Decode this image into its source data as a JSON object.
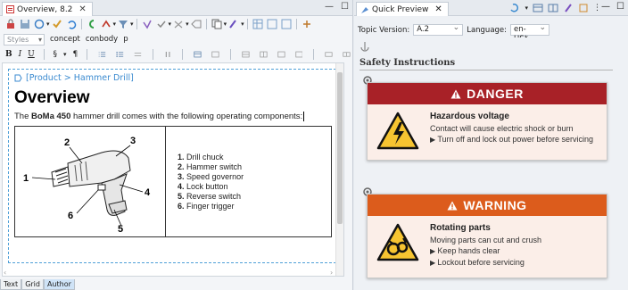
{
  "editor": {
    "tab_title": "Overview, 8.2",
    "styles_placeholder": "Styles",
    "tag_concept": "concept",
    "tag_conbody": "conbody",
    "tag_p": "p",
    "breadcrumb": "[Product > Hammer Drill]",
    "heading": "Overview",
    "intro_prefix": "The ",
    "intro_product": "BoMa 450",
    "intro_suffix": " hammer drill comes with the following operating components:",
    "callouts": [
      "1",
      "2",
      "3",
      "4",
      "5",
      "6"
    ],
    "parts": [
      {
        "num": "1.",
        "name": "Drill chuck"
      },
      {
        "num": "2.",
        "name": "Hammer switch"
      },
      {
        "num": "3.",
        "name": "Speed governor"
      },
      {
        "num": "4.",
        "name": "Lock button"
      },
      {
        "num": "5.",
        "name": "Reverse switch"
      },
      {
        "num": "6.",
        "name": "Finger trigger"
      }
    ],
    "bottom_tabs": [
      "Text",
      "Grid",
      "Author"
    ],
    "active_bottom_tab": "Author"
  },
  "preview": {
    "tab_title": "Quick Preview",
    "topic_version_label": "Topic Version:",
    "topic_version_value": "A.2",
    "language_label": "Language:",
    "language_value": "en-US*",
    "section_title": "Safety Instructions",
    "danger": {
      "label": "DANGER",
      "color": "#a82127",
      "title": "Hazardous voltage",
      "line1": "Contact will cause electric shock or burn",
      "bullet1": "Turn off and lock out power before servicing"
    },
    "warning": {
      "label": "WARNING",
      "color": "#dc5c1c",
      "title": "Rotating parts",
      "line1": "Moving parts can cut and crush",
      "bullet1": "Keep hands clear",
      "bullet2": "Lockout before servicing"
    }
  }
}
